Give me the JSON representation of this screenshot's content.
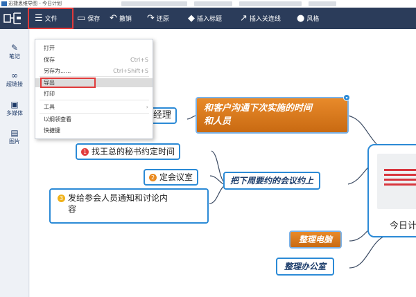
{
  "window": {
    "title": "迅捷思维导图 - 今日计划"
  },
  "toolbar": {
    "file": "文件",
    "save": "保存",
    "undo": "撤销",
    "redo": "还原",
    "insert_label": "插入标题",
    "insert_relation": "插入关连线",
    "style": "风格"
  },
  "sidebar": {
    "items": [
      {
        "label": "笔记",
        "icon": "pencil-icon"
      },
      {
        "label": "超链接",
        "icon": "link-icon"
      },
      {
        "label": "多媒体",
        "icon": "media-icon"
      },
      {
        "label": "图片",
        "icon": "image-icon"
      }
    ]
  },
  "file_menu": {
    "items": [
      {
        "label": "打开",
        "shortcut": ""
      },
      {
        "label": "保存",
        "shortcut": "Ctrl+S"
      },
      {
        "label": "另存为......",
        "shortcut": "Ctrl+Shift+S"
      },
      {
        "label": "导出",
        "shortcut": "",
        "highlighted": true
      },
      {
        "label": "打印",
        "shortcut": ""
      },
      {
        "label": "工具",
        "shortcut": "›"
      },
      {
        "label": "以纲领查看",
        "shortcut": ""
      },
      {
        "label": "快捷键",
        "shortcut": ""
      }
    ]
  },
  "mindmap": {
    "center": "今日计",
    "topics": {
      "manager": "经理",
      "communicate_line1": "和客户沟通下次实施的时间",
      "communicate_line2": "和人员",
      "next_week": "把下周要约的会议约上",
      "computer": "整理电脑",
      "office": "整理办公室"
    },
    "subtopics": [
      {
        "badge": "1",
        "text": "找王总的秘书约定时间",
        "badge_color": "#e23b3b"
      },
      {
        "badge": "2",
        "text": "定会议室",
        "badge_color": "#e98a1f"
      },
      {
        "badge": "3",
        "text_line1": "发给参会人员通知和讨论内",
        "text_line2": "容",
        "badge_color": "#f0b21a"
      }
    ]
  },
  "colors": {
    "toolbar_bg": "#2b3c5a",
    "accent_blue": "#2b8ad6",
    "orange_topic": "#d9781c",
    "highlight_red": "#e03a3a"
  }
}
